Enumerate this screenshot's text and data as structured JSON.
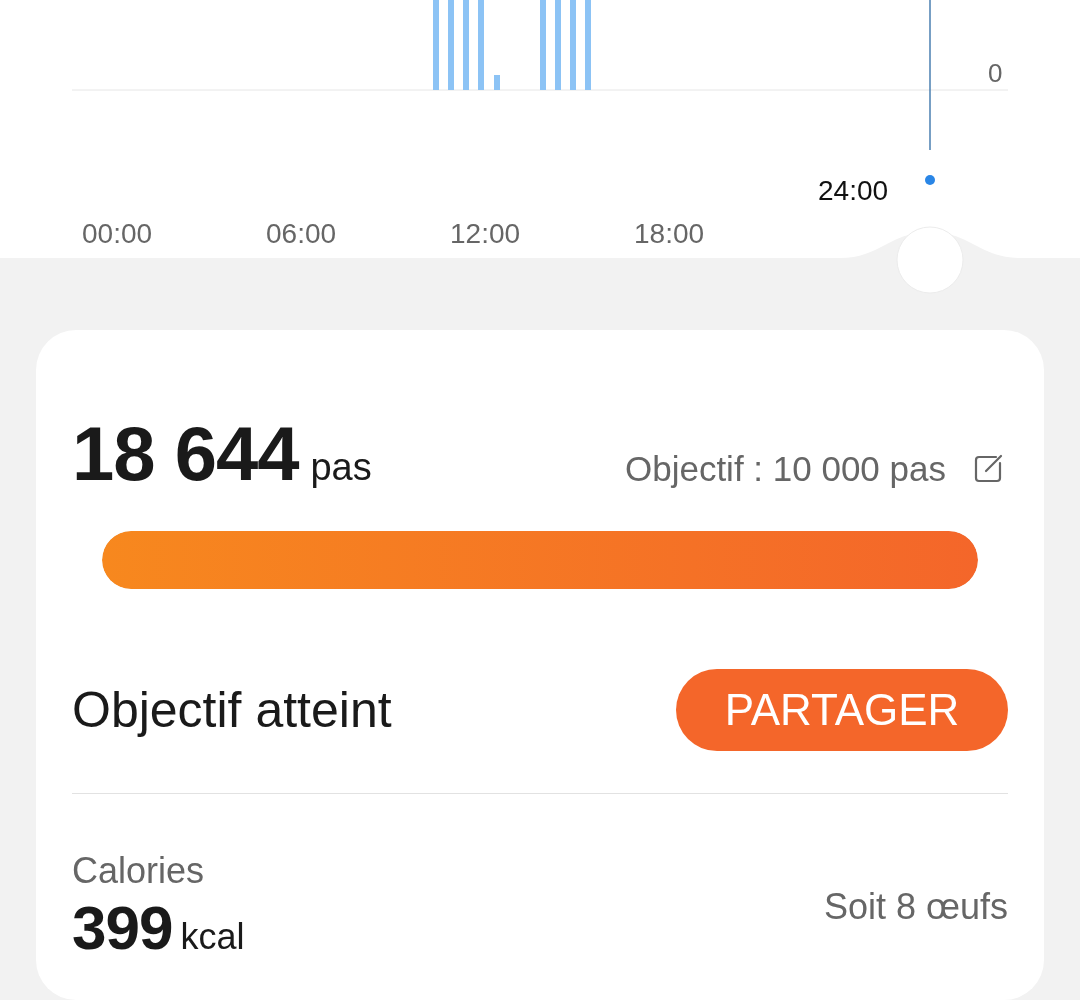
{
  "chart": {
    "y_tick": "0",
    "cursor_label": "24:00",
    "x_labels": [
      "00:00",
      "06:00",
      "12:00",
      "18:00"
    ]
  },
  "steps": {
    "value": "18 644",
    "unit": "pas",
    "goal": "Objectif : 10 000 pas",
    "level": 1
  },
  "status": {
    "text": "Objectif atteint",
    "button": "PARTAGER"
  },
  "calories": {
    "label": "Calories",
    "value": "399",
    "unit": "kcal",
    "equivalent": "Soit 8 œufs"
  }
}
